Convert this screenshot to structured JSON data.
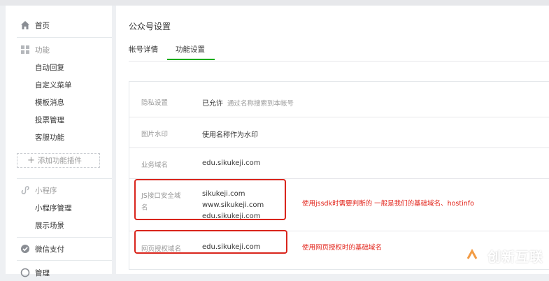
{
  "sidebar": {
    "home": {
      "label": "首页",
      "icon": "home-icon"
    },
    "features": {
      "label": "功能",
      "icon": "grid-icon",
      "items": [
        "自动回复",
        "自定义菜单",
        "模板消息",
        "投票管理",
        "客服功能"
      ],
      "add_plugin": "添加功能插件"
    },
    "miniprogram": {
      "label": "小程序",
      "icon": "miniprogram-icon",
      "items": [
        "小程序管理",
        "展示场景"
      ]
    },
    "pay": {
      "label": "微信支付",
      "icon": "wechat-pay-icon"
    },
    "manage": {
      "label": "管理",
      "icon": "manage-icon"
    }
  },
  "main": {
    "title": "公众号设置",
    "tabs": [
      {
        "label": "帐号详情",
        "active": false
      },
      {
        "label": "功能设置",
        "active": true
      }
    ],
    "settings": [
      {
        "label": "隐私设置",
        "value": "已允许",
        "note": "通过名称搜索到本帐号"
      },
      {
        "label": "图片水印",
        "value": "使用名称作为水印"
      },
      {
        "label": "业务域名",
        "value": "edu.sikukeji.com"
      },
      {
        "label_lines": [
          "JS接口安全域",
          "名"
        ],
        "values": [
          "sikukeji.com",
          "www.sikukeji.com",
          "edu.sikukeji.com"
        ]
      },
      {
        "label": "网页授权域名",
        "value": "edu.sikukeji.com"
      }
    ],
    "annotations": {
      "js_domain": "使用jssdk时需要判断的  一般是我们的基础域名、hostinfo",
      "oauth_domain": "使用网页授权时的基础域名"
    }
  },
  "brand": {
    "name": "创新互联"
  },
  "colors": {
    "accent_green": "#1aad19",
    "highlight_red": "#d9251c",
    "annotation_red": "#e2231a"
  }
}
